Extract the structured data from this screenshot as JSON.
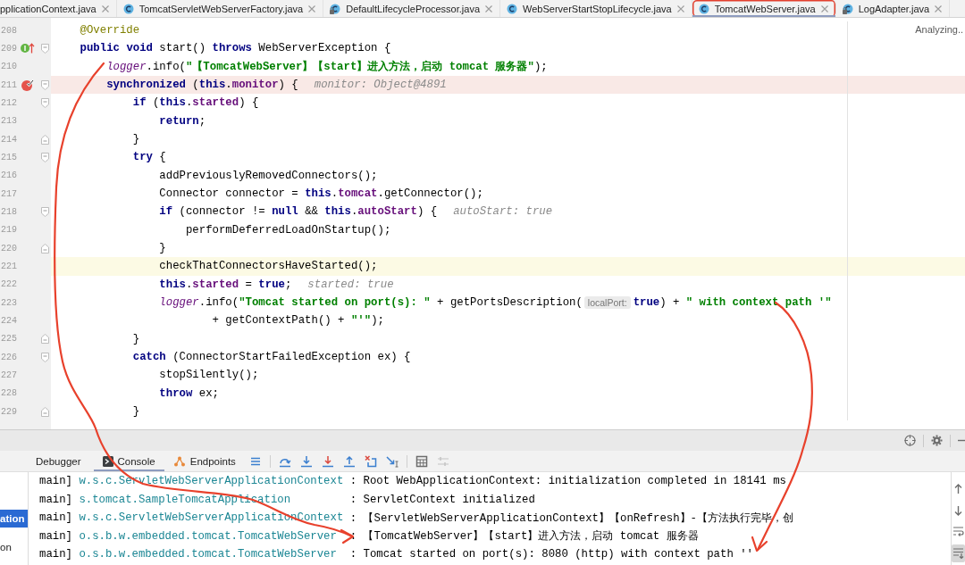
{
  "editor_tabs": [
    {
      "label": "pplicationContext.java",
      "kind": "clipped",
      "selected": false,
      "circled": false
    },
    {
      "label": "TomcatServletWebServerFactory.java",
      "kind": "class",
      "selected": false,
      "circled": false
    },
    {
      "label": "DefaultLifecycleProcessor.java",
      "kind": "library",
      "selected": false,
      "circled": false
    },
    {
      "label": "WebServerStartStopLifecycle.java",
      "kind": "class",
      "selected": false,
      "circled": false
    },
    {
      "label": "TomcatWebServer.java",
      "kind": "class",
      "selected": true,
      "circled": true
    },
    {
      "label": "LogAdapter.java",
      "kind": "library",
      "selected": false,
      "circled": false
    }
  ],
  "editor": {
    "status": "Analyzing..",
    "lines": [
      {
        "number": "208",
        "kind": "plain",
        "selected": false,
        "tokens": [
          {
            "kind": "annotation",
            "text": "@Override"
          }
        ]
      },
      {
        "number": "209",
        "kind": "override",
        "selected": false,
        "tokens": [
          {
            "kind": "keyword",
            "text": "public "
          },
          {
            "kind": "keyword",
            "text": "void"
          },
          {
            "kind": "plain",
            "text": " start() "
          },
          {
            "kind": "keyword",
            "text": "throws"
          },
          {
            "kind": "plain",
            "text": " WebServerException {"
          }
        ],
        "children": [
          {
            "number": "210",
            "kind": "plain",
            "selected": false,
            "tokens": [
              {
                "kind": "static_field",
                "text": "logger"
              },
              {
                "kind": "plain",
                "text": ".info("
              },
              {
                "kind": "string",
                "text": "\"【TomcatWebServer】【start】进入方法，启动 tomcat 服务器\""
              },
              {
                "kind": "plain",
                "text": ");"
              }
            ]
          },
          {
            "number": "211",
            "kind": "breakpoint",
            "selected": false,
            "tokens": [
              {
                "kind": "keyword",
                "text": "synchronized"
              },
              {
                "kind": "plain",
                "text": " ("
              },
              {
                "kind": "keyword",
                "text": "this"
              },
              {
                "kind": "plain",
                "text": "."
              },
              {
                "kind": "field",
                "text": "monitor"
              },
              {
                "kind": "plain",
                "text": ") {"
              },
              {
                "kind": "value_hint",
                "text": "monitor: Object@4891"
              }
            ],
            "children": [
              {
                "number": "212",
                "kind": "plain",
                "selected": false,
                "tokens": [
                  {
                    "kind": "keyword",
                    "text": "if"
                  },
                  {
                    "kind": "plain",
                    "text": " ("
                  },
                  {
                    "kind": "keyword",
                    "text": "this"
                  },
                  {
                    "kind": "plain",
                    "text": "."
                  },
                  {
                    "kind": "field",
                    "text": "started"
                  },
                  {
                    "kind": "plain",
                    "text": ") {"
                  }
                ],
                "children": [
                  {
                    "number": "213",
                    "kind": "plain",
                    "selected": false,
                    "tokens": [
                      {
                        "kind": "keyword",
                        "text": "return"
                      },
                      {
                        "kind": "plain",
                        "text": ";"
                      }
                    ]
                  }
                ]
              },
              {
                "number": "214",
                "kind": "plain",
                "selected": false,
                "tokens": [
                  {
                    "kind": "plain",
                    "text": "}"
                  }
                ]
              },
              {
                "number": "215",
                "kind": "plain",
                "selected": false,
                "tokens": [
                  {
                    "kind": "keyword",
                    "text": "try"
                  },
                  {
                    "kind": "plain",
                    "text": " {"
                  }
                ],
                "children": [
                  {
                    "number": "216",
                    "kind": "plain",
                    "selected": false,
                    "tokens": [
                      {
                        "kind": "plain",
                        "text": "addPreviouslyRemovedConnectors();"
                      }
                    ]
                  },
                  {
                    "number": "217",
                    "kind": "plain",
                    "selected": false,
                    "tokens": [
                      {
                        "kind": "plain",
                        "text": "Connector connector = "
                      },
                      {
                        "kind": "keyword",
                        "text": "this"
                      },
                      {
                        "kind": "plain",
                        "text": "."
                      },
                      {
                        "kind": "field",
                        "text": "tomcat"
                      },
                      {
                        "kind": "plain",
                        "text": ".getConnector();"
                      }
                    ]
                  },
                  {
                    "number": "218",
                    "kind": "plain",
                    "selected": false,
                    "tokens": [
                      {
                        "kind": "keyword",
                        "text": "if"
                      },
                      {
                        "kind": "plain",
                        "text": " (connector != "
                      },
                      {
                        "kind": "keyword",
                        "text": "null"
                      },
                      {
                        "kind": "plain",
                        "text": " && "
                      },
                      {
                        "kind": "keyword",
                        "text": "this"
                      },
                      {
                        "kind": "plain",
                        "text": "."
                      },
                      {
                        "kind": "field",
                        "text": "autoStart"
                      },
                      {
                        "kind": "plain",
                        "text": ") {"
                      },
                      {
                        "kind": "value_hint",
                        "text": "autoStart: true"
                      }
                    ],
                    "children": [
                      {
                        "number": "219",
                        "kind": "plain",
                        "selected": false,
                        "tokens": [
                          {
                            "kind": "plain",
                            "text": "performDeferredLoadOnStartup();"
                          }
                        ]
                      }
                    ]
                  },
                  {
                    "number": "220",
                    "kind": "plain",
                    "selected": false,
                    "tokens": [
                      {
                        "kind": "plain",
                        "text": "}"
                      }
                    ]
                  },
                  {
                    "number": "221",
                    "kind": "plain",
                    "selected": true,
                    "tokens": [
                      {
                        "kind": "plain",
                        "text": "checkThatConnectorsHaveStarted();"
                      }
                    ]
                  },
                  {
                    "number": "222",
                    "kind": "plain",
                    "selected": false,
                    "tokens": [
                      {
                        "kind": "keyword",
                        "text": "this"
                      },
                      {
                        "kind": "plain",
                        "text": "."
                      },
                      {
                        "kind": "field",
                        "text": "started"
                      },
                      {
                        "kind": "plain",
                        "text": " = "
                      },
                      {
                        "kind": "keyword",
                        "text": "true"
                      },
                      {
                        "kind": "plain",
                        "text": ";"
                      },
                      {
                        "kind": "value_hint",
                        "text": "started: true"
                      }
                    ]
                  },
                  {
                    "number": "223",
                    "kind": "plain",
                    "selected": false,
                    "tokens": [
                      {
                        "kind": "static_field",
                        "text": "logger"
                      },
                      {
                        "kind": "plain",
                        "text": ".info("
                      },
                      {
                        "kind": "string",
                        "text": "\"Tomcat started on port(s): \""
                      },
                      {
                        "kind": "plain",
                        "text": " + getPortsDescription("
                      },
                      {
                        "kind": "param_hint",
                        "text": "localPort:"
                      },
                      {
                        "kind": "keyword",
                        "text": "true"
                      },
                      {
                        "kind": "plain",
                        "text": ") + "
                      },
                      {
                        "kind": "string",
                        "text": "\" with context path '\""
                      }
                    ],
                    "continuation": {
                      "number": "224",
                      "kind": "plain",
                      "selected": false,
                      "tokens": [
                        {
                          "kind": "plain",
                          "text": "+ getContextPath() + "
                        },
                        {
                          "kind": "string",
                          "text": "\"'\""
                        },
                        {
                          "kind": "plain",
                          "text": ");"
                        }
                      ]
                    }
                  }
                ]
              },
              {
                "number": "225",
                "kind": "plain",
                "selected": false,
                "tokens": [
                  {
                    "kind": "plain",
                    "text": "}"
                  }
                ]
              },
              {
                "number": "226",
                "kind": "plain",
                "selected": false,
                "tokens": [
                  {
                    "kind": "keyword",
                    "text": "catch"
                  },
                  {
                    "kind": "plain",
                    "text": " (ConnectorStartFailedException ex) {"
                  }
                ],
                "children": [
                  {
                    "number": "227",
                    "kind": "plain",
                    "selected": false,
                    "tokens": [
                      {
                        "kind": "plain",
                        "text": "stopSilently();"
                      }
                    ]
                  },
                  {
                    "number": "228",
                    "kind": "plain",
                    "selected": false,
                    "tokens": [
                      {
                        "kind": "keyword",
                        "text": "throw"
                      },
                      {
                        "kind": "plain",
                        "text": " ex;"
                      }
                    ]
                  }
                ]
              },
              {
                "number": "229",
                "kind": "plain",
                "selected": false,
                "tokens": [
                  {
                    "kind": "plain",
                    "text": "}"
                  }
                ]
              }
            ]
          }
        ]
      }
    ]
  },
  "debug_panel": {
    "tabs": [
      {
        "label": "Debugger",
        "kind": "debugger",
        "selected": false
      },
      {
        "label": "Console",
        "kind": "console",
        "selected": true
      },
      {
        "label": "Endpoints",
        "kind": "endpoints",
        "selected": false
      }
    ],
    "toolbar_groups": [
      [
        {
          "kind": "list",
          "disabled": false
        }
      ],
      [
        {
          "kind": "step_over",
          "disabled": false
        },
        {
          "kind": "step_into",
          "disabled": false
        },
        {
          "kind": "force_step_into",
          "disabled": false
        },
        {
          "kind": "step_out",
          "disabled": false
        },
        {
          "kind": "drop_frame",
          "disabled": false
        },
        {
          "kind": "run_to_cursor",
          "disabled": false
        }
      ],
      [
        {
          "kind": "evaluate",
          "disabled": false
        },
        {
          "kind": "trace",
          "disabled": true
        }
      ]
    ],
    "tree_items": [
      {
        "label": "ation",
        "selected": true
      },
      {
        "label": "on",
        "selected": false
      }
    ],
    "console_lines": [
      {
        "thread": "main]",
        "logger": "w.s.c.ServletWebServerApplicationContext",
        "message": ": Root WebApplicationContext: initialization completed in 18141 ms"
      },
      {
        "thread": "main]",
        "logger": "s.tomcat.SampleTomcatApplication",
        "message": ": ServletContext initialized"
      },
      {
        "thread": "main]",
        "logger": "w.s.c.ServletWebServerApplicationContext",
        "message": ": 【ServletWebServerApplicationContext】【onRefresh】-【方法执行完毕，创"
      },
      {
        "thread": "main]",
        "logger": "o.s.b.w.embedded.tomcat.TomcatWebServer",
        "message": ": 【TomcatWebServer】【start】进入方法，启动 tomcat 服务器"
      },
      {
        "thread": "main]",
        "logger": "o.s.b.w.embedded.tomcat.TomcatWebServer",
        "message": ": Tomcat started on port(s): 8080 (http) with context path ''"
      }
    ],
    "side_toolbar": [
      {
        "kind": "up",
        "on": false
      },
      {
        "kind": "down",
        "on": false
      },
      {
        "kind": "wrap",
        "on": false
      },
      {
        "kind": "scroll_end",
        "on": true
      }
    ]
  }
}
